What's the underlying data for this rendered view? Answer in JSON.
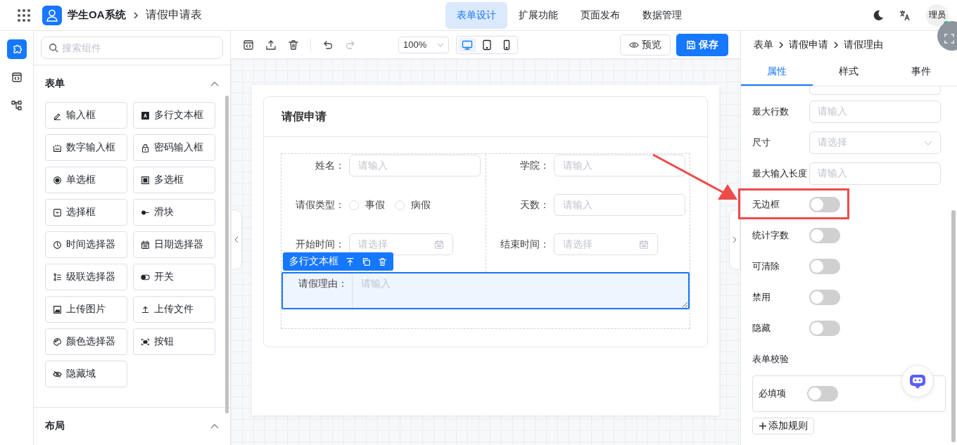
{
  "header": {
    "app_name": "学生OA系统",
    "page_title": "请假申请表",
    "nav": [
      {
        "label": "表单设计",
        "selected": true
      },
      {
        "label": "扩展功能",
        "selected": false
      },
      {
        "label": "页面发布",
        "selected": false
      },
      {
        "label": "数据管理",
        "selected": false
      }
    ],
    "avatar": {
      "text": "理员",
      "online": true
    }
  },
  "rail": [
    {
      "kind": "puzzle",
      "selected": true
    },
    {
      "kind": "code",
      "selected": false
    },
    {
      "kind": "tree",
      "selected": false
    }
  ],
  "components": {
    "search_placeholder": "搜索组件",
    "groups": [
      {
        "title": "表单",
        "expanded": true,
        "items": [
          {
            "kind": "pen",
            "label": "输入框"
          },
          {
            "kind": "textbox",
            "label": "多行文本框"
          },
          {
            "kind": "number",
            "label": "数字输入框"
          },
          {
            "kind": "lock",
            "label": "密码输入框"
          },
          {
            "kind": "radio",
            "label": "单选框"
          },
          {
            "kind": "checkbox",
            "label": "多选框"
          },
          {
            "kind": "select",
            "label": "选择框"
          },
          {
            "kind": "slider",
            "label": "滑块"
          },
          {
            "kind": "clock",
            "label": "时间选择器"
          },
          {
            "kind": "calendar",
            "label": "日期选择器"
          },
          {
            "kind": "cascade",
            "label": "级联选择器"
          },
          {
            "kind": "switch",
            "label": "开关"
          },
          {
            "kind": "image",
            "label": "上传图片"
          },
          {
            "kind": "upload",
            "label": "上传文件"
          },
          {
            "kind": "palette",
            "label": "颜色选择器"
          },
          {
            "kind": "button",
            "label": "按钮"
          },
          {
            "kind": "eyeoff",
            "label": "隐藏域"
          }
        ]
      },
      {
        "title": "布局",
        "expanded": true
      }
    ]
  },
  "toolbar": {
    "actions": [
      {
        "kind": "code",
        "disabled": false
      },
      {
        "kind": "export",
        "disabled": false
      },
      {
        "kind": "trash",
        "disabled": false
      },
      {
        "kind": "undo",
        "disabled": false
      },
      {
        "kind": "redo",
        "disabled": true
      }
    ],
    "zoom": "100%",
    "devices": [
      {
        "kind": "desktop",
        "selected": true
      },
      {
        "kind": "tablet",
        "selected": false
      },
      {
        "kind": "phone",
        "selected": false
      }
    ],
    "preview": "预览",
    "save": "保存"
  },
  "form": {
    "title": "请假申请",
    "left_column": [
      {
        "kind": "input",
        "label": "姓名：",
        "placeholder": "请输入"
      },
      {
        "kind": "radio",
        "label": "请假类型：",
        "options": [
          {
            "label": "事假",
            "selected": false
          },
          {
            "label": "病假",
            "selected": false
          }
        ]
      },
      {
        "kind": "date",
        "label": "开始时间：",
        "placeholder": "请选择"
      }
    ],
    "right_column": [
      {
        "kind": "input",
        "label": "学院：",
        "placeholder": "请输入"
      },
      {
        "kind": "input",
        "label": "天数：",
        "placeholder": "请输入"
      },
      {
        "kind": "date",
        "label": "结束时间：",
        "placeholder": "请选择"
      }
    ],
    "textarea": {
      "label": "请假理由：",
      "placeholder": "请输入",
      "selected": true,
      "tag": "多行文本框"
    }
  },
  "inspector": {
    "breadcrumb": [
      "表单",
      "请假申请",
      "请假理由"
    ],
    "tabs": [
      {
        "label": "属性",
        "selected": true
      },
      {
        "label": "样式",
        "selected": false
      },
      {
        "label": "事件",
        "selected": false
      }
    ],
    "properties": [
      {
        "kind": "input",
        "label": "最大行数",
        "placeholder": "请输入",
        "highlighted": false
      },
      {
        "kind": "select",
        "label": "尺寸",
        "placeholder": "请选择",
        "highlighted": false
      },
      {
        "kind": "input",
        "label": "最大输入长度",
        "placeholder": "请输入",
        "highlighted": false
      },
      {
        "kind": "switch",
        "label": "无边框",
        "on": false,
        "highlighted": true
      },
      {
        "kind": "switch",
        "label": "统计字数",
        "on": false,
        "highlighted": false
      },
      {
        "kind": "switch",
        "label": "可清除",
        "on": false,
        "highlighted": false
      },
      {
        "kind": "switch",
        "label": "禁用",
        "on": false,
        "highlighted": false
      },
      {
        "kind": "switch",
        "label": "隐藏",
        "on": false,
        "highlighted": false
      }
    ],
    "validation": {
      "title": "表单校验",
      "rules": [
        {
          "label": "必填项",
          "on": false
        }
      ],
      "add_button": "添加规则"
    }
  }
}
